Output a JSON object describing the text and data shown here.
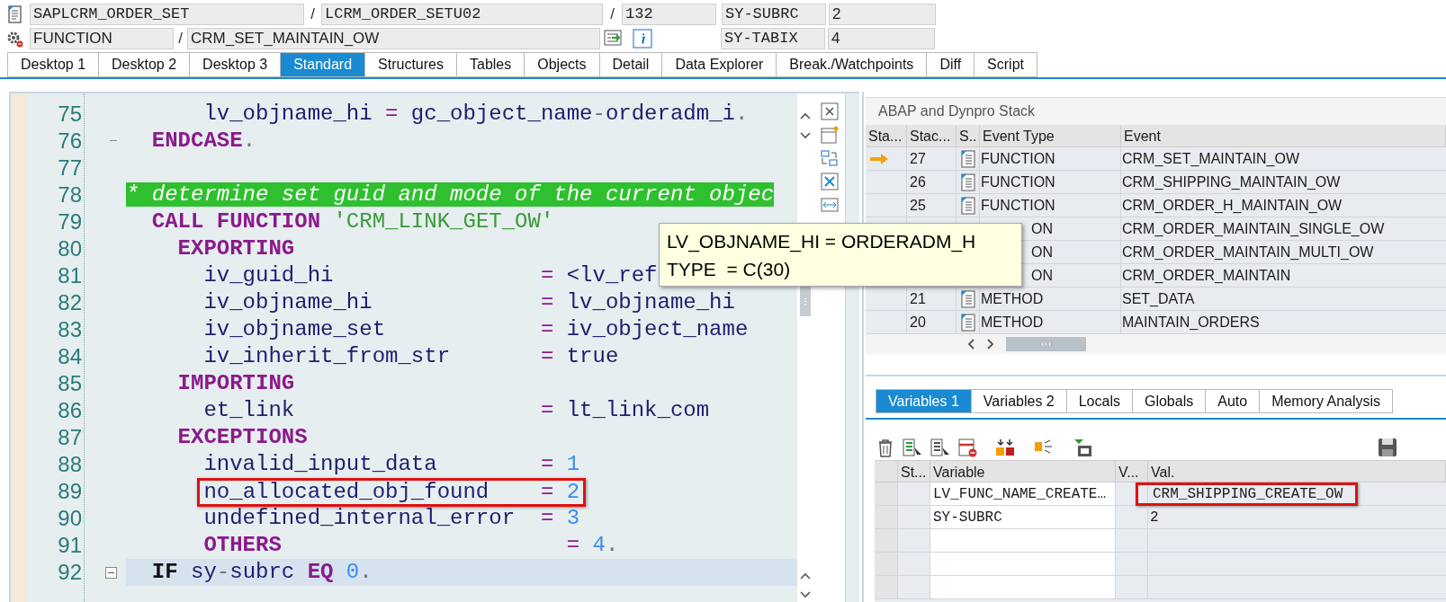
{
  "header": {
    "program": "SAPLCRM_ORDER_SET",
    "include": "LCRM_ORDER_SETU02",
    "line": "132",
    "event_type": "FUNCTION",
    "event": "CRM_SET_MAINTAIN_OW",
    "separators": [
      "/",
      "/",
      "/"
    ],
    "sy_fields": [
      {
        "name": "SY-SUBRC",
        "value": "2"
      },
      {
        "name": "SY-TABIX",
        "value": "4"
      }
    ]
  },
  "tabs": [
    {
      "label": "Desktop 1",
      "selected": false
    },
    {
      "label": "Desktop 2",
      "selected": false
    },
    {
      "label": "Desktop 3",
      "selected": false
    },
    {
      "label": "Standard",
      "selected": true
    },
    {
      "label": "Structures",
      "selected": false
    },
    {
      "label": "Tables",
      "selected": false
    },
    {
      "label": "Objects",
      "selected": false
    },
    {
      "label": "Detail",
      "selected": false
    },
    {
      "label": "Data Explorer",
      "selected": false
    },
    {
      "label": "Break./Watchpoints",
      "selected": false
    },
    {
      "label": "Diff",
      "selected": false
    },
    {
      "label": "Script",
      "selected": false
    }
  ],
  "editor": {
    "lines": [
      {
        "number": "75",
        "current": false,
        "highlighted": false,
        "tokens": [
          {
            "kind": "plain",
            "text": "      lv_objname_hi "
          },
          {
            "kind": "operator",
            "text": "="
          },
          {
            "kind": "plain",
            "text": " gc_object_name"
          },
          {
            "kind": "punct",
            "text": "-"
          },
          {
            "kind": "plain",
            "text": "orderadm_i"
          },
          {
            "kind": "punct",
            "text": "."
          }
        ]
      },
      {
        "number": "76",
        "current": false,
        "highlighted": false,
        "block_end": true,
        "tokens": [
          {
            "kind": "keyword",
            "text": "  ENDCASE"
          },
          {
            "kind": "punct",
            "text": "."
          }
        ]
      },
      {
        "number": "77",
        "current": false,
        "highlighted": false
      },
      {
        "number": "78",
        "current": false,
        "highlighted": false,
        "tokens": [
          {
            "kind": "comment",
            "text": "* determine set guid and mode of the current objec"
          }
        ]
      },
      {
        "number": "79",
        "current": false,
        "highlighted": false,
        "tokens": [
          {
            "kind": "keyword",
            "text": "  CALL FUNCTION"
          },
          {
            "kind": "string",
            "text": " 'CRM_LINK_GET_OW'"
          }
        ]
      },
      {
        "number": "80",
        "current": false,
        "highlighted": false,
        "tokens": [
          {
            "kind": "keyword",
            "text": "    EXPORTING"
          }
        ]
      },
      {
        "number": "81",
        "current": false,
        "highlighted": false,
        "tokens": [
          {
            "kind": "plain",
            "text": "      iv_guid_hi                "
          },
          {
            "kind": "operator",
            "text": "="
          },
          {
            "kind": "plain",
            "text": " <lv_ref"
          }
        ]
      },
      {
        "number": "82",
        "current": false,
        "highlighted": false,
        "tokens": [
          {
            "kind": "plain",
            "text": "      iv_objname_hi             "
          },
          {
            "kind": "operator",
            "text": "="
          },
          {
            "kind": "plain",
            "text": " lv_objname_hi"
          }
        ]
      },
      {
        "number": "83",
        "current": false,
        "highlighted": false,
        "tokens": [
          {
            "kind": "plain",
            "text": "      iv_objname_set            "
          },
          {
            "kind": "operator",
            "text": "="
          },
          {
            "kind": "plain",
            "text": " iv_object_name"
          }
        ]
      },
      {
        "number": "84",
        "current": false,
        "highlighted": false,
        "tokens": [
          {
            "kind": "plain",
            "text": "      iv_inherit_from_str       "
          },
          {
            "kind": "operator",
            "text": "="
          },
          {
            "kind": "plain",
            "text": " true"
          }
        ]
      },
      {
        "number": "85",
        "current": false,
        "highlighted": false,
        "tokens": [
          {
            "kind": "keyword",
            "text": "    IMPORTING"
          }
        ]
      },
      {
        "number": "86",
        "current": false,
        "highlighted": false,
        "tokens": [
          {
            "kind": "plain",
            "text": "      et_link                   "
          },
          {
            "kind": "operator",
            "text": "="
          },
          {
            "kind": "plain",
            "text": " lt_link_com"
          }
        ]
      },
      {
        "number": "87",
        "current": false,
        "highlighted": false,
        "tokens": [
          {
            "kind": "keyword",
            "text": "    EXCEPTIONS"
          }
        ]
      },
      {
        "number": "88",
        "current": false,
        "highlighted": false,
        "tokens": [
          {
            "kind": "plain",
            "text": "      invalid_input_data        "
          },
          {
            "kind": "operator",
            "text": "="
          },
          {
            "kind": "number",
            "text": " 1"
          }
        ]
      },
      {
        "number": "89",
        "current": false,
        "highlighted": true,
        "tokens": [
          {
            "kind": "plain",
            "text": "      no_allocated_obj_found    "
          },
          {
            "kind": "operator",
            "text": "="
          },
          {
            "kind": "number",
            "text": " 2"
          }
        ]
      },
      {
        "number": "90",
        "current": false,
        "highlighted": false,
        "tokens": [
          {
            "kind": "plain",
            "text": "      undefined_internal_error  "
          },
          {
            "kind": "operator",
            "text": "="
          },
          {
            "kind": "number",
            "text": " 3"
          }
        ]
      },
      {
        "number": "91",
        "current": false,
        "highlighted": false,
        "tokens": [
          {
            "kind": "keyword",
            "text": "      OTHERS"
          },
          {
            "kind": "operator",
            "text": "                      ="
          },
          {
            "kind": "number",
            "text": " 4"
          },
          {
            "kind": "punct",
            "text": "."
          }
        ]
      },
      {
        "number": "92",
        "current": true,
        "highlighted": false,
        "collapsible": true,
        "tokens": [
          {
            "kind": "control",
            "text": "  IF"
          },
          {
            "kind": "plain",
            "text": " sy"
          },
          {
            "kind": "punct",
            "text": "-"
          },
          {
            "kind": "plain",
            "text": "subrc "
          },
          {
            "kind": "keyword",
            "text": "EQ"
          },
          {
            "kind": "number",
            "text": " 0"
          },
          {
            "kind": "punct",
            "text": "."
          }
        ]
      }
    ]
  },
  "stack": {
    "title": "ABAP and Dynpro Stack",
    "columns": [
      "Sta...",
      "Stac...",
      "S..",
      "Event Type",
      "Event"
    ],
    "rows": [
      {
        "current": true,
        "stack_no": "27",
        "event_type": "FUNCTION",
        "event": "CRM_SET_MAINTAIN_OW"
      },
      {
        "current": false,
        "stack_no": "26",
        "event_type": "FUNCTION",
        "event": "CRM_SHIPPING_MAINTAIN_OW"
      },
      {
        "current": false,
        "stack_no": "25",
        "event_type": "FUNCTION",
        "event": "CRM_ORDER_H_MAINTAIN_OW"
      },
      {
        "current": false,
        "event_type_tail": "ON",
        "event": "CRM_ORDER_MAINTAIN_SINGLE_OW"
      },
      {
        "current": false,
        "event_type_tail": "ON",
        "event": "CRM_ORDER_MAINTAIN_MULTI_OW"
      },
      {
        "current": false,
        "event_type_tail": "ON",
        "event": "CRM_ORDER_MAINTAIN"
      },
      {
        "current": false,
        "stack_no": "21",
        "event_type": "METHOD",
        "event": "SET_DATA"
      },
      {
        "current": false,
        "stack_no": "20",
        "event_type": "METHOD",
        "event": "MAINTAIN_ORDERS"
      }
    ]
  },
  "tooltip": {
    "lines": [
      "LV_OBJNAME_HI = ORDERADM_H",
      "TYPE  = C(30)"
    ]
  },
  "variable_tabs": [
    {
      "label": "Variables 1",
      "selected": true
    },
    {
      "label": "Variables 2",
      "selected": false
    },
    {
      "label": "Locals",
      "selected": false
    },
    {
      "label": "Globals",
      "selected": false
    },
    {
      "label": "Auto",
      "selected": false
    },
    {
      "label": "Memory Analysis",
      "selected": false
    }
  ],
  "variables": {
    "columns": [
      "St...",
      "Variable",
      "V...",
      "Val."
    ],
    "rows": [
      {
        "variable": "LV_FUNC_NAME_CREATE…",
        "value": "CRM_SHIPPING_CREATE_OW",
        "highlighted": true
      },
      {
        "variable": "SY-SUBRC",
        "value": "2",
        "highlighted": false
      }
    ]
  }
}
